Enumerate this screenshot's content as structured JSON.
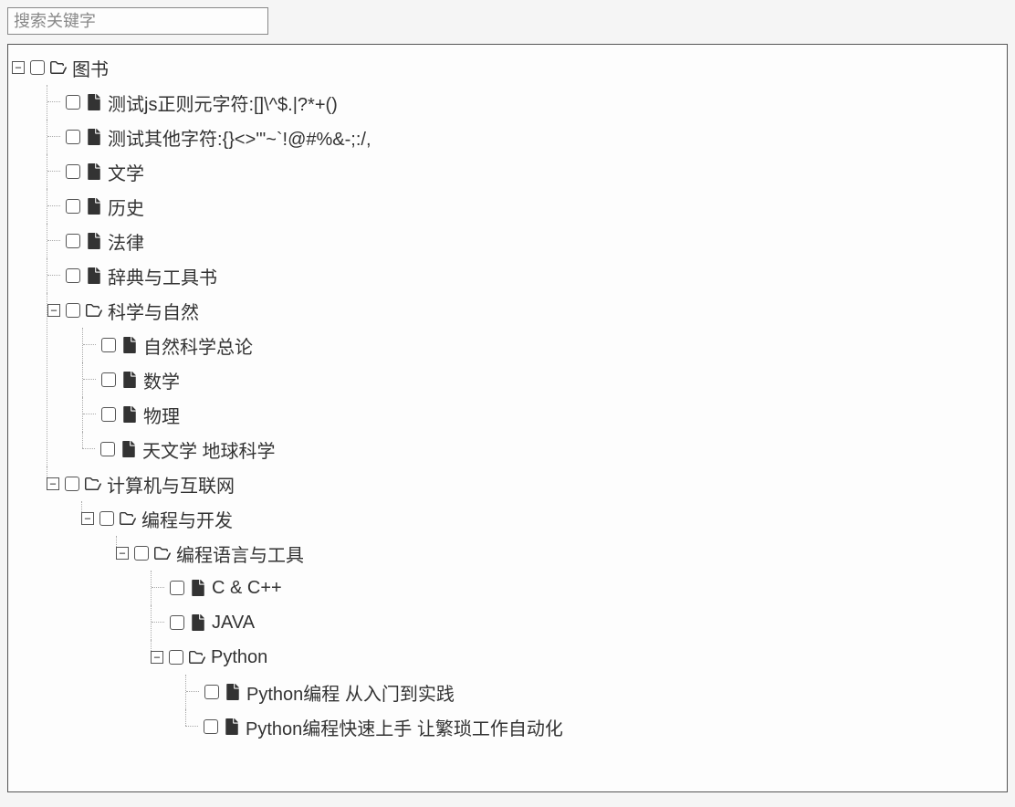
{
  "search": {
    "placeholder": "搜索关键字"
  },
  "tree": [
    {
      "label": "图书",
      "type": "folder",
      "expanded": true,
      "children": [
        {
          "label": "测试js正则元字符:[]\\^$.|?*+()",
          "type": "file"
        },
        {
          "label": "测试其他字符:{}<>'\"~`!@#%&-;:/,",
          "type": "file"
        },
        {
          "label": "文学",
          "type": "file"
        },
        {
          "label": "历史",
          "type": "file"
        },
        {
          "label": "法律",
          "type": "file"
        },
        {
          "label": "辞典与工具书",
          "type": "file"
        },
        {
          "label": "科学与自然",
          "type": "folder",
          "expanded": true,
          "children": [
            {
              "label": "自然科学总论",
              "type": "file"
            },
            {
              "label": "数学",
              "type": "file"
            },
            {
              "label": "物理",
              "type": "file"
            },
            {
              "label": "天文学 地球科学",
              "type": "file"
            }
          ]
        },
        {
          "label": "计算机与互联网",
          "type": "folder",
          "expanded": true,
          "children": [
            {
              "label": "编程与开发",
              "type": "folder",
              "expanded": true,
              "children": [
                {
                  "label": "编程语言与工具",
                  "type": "folder",
                  "expanded": true,
                  "children": [
                    {
                      "label": "C & C++",
                      "type": "file"
                    },
                    {
                      "label": "JAVA",
                      "type": "file"
                    },
                    {
                      "label": "Python",
                      "type": "folder",
                      "expanded": true,
                      "children": [
                        {
                          "label": "Python编程 从入门到实践",
                          "type": "file"
                        },
                        {
                          "label": "Python编程快速上手 让繁琐工作自动化",
                          "type": "file"
                        }
                      ]
                    }
                  ]
                }
              ]
            }
          ]
        }
      ]
    }
  ]
}
